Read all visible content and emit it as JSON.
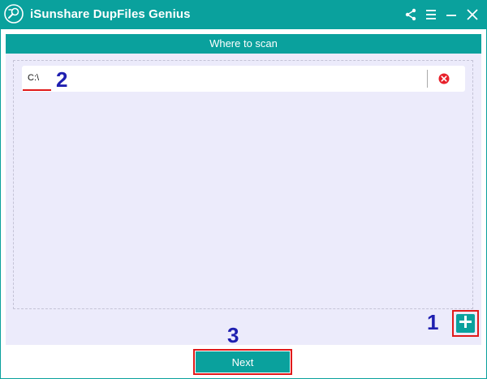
{
  "window": {
    "title": "iSunshare DupFiles Genius",
    "icons": [
      "app-logo-icon",
      "share-icon",
      "menu-icon",
      "minimize-icon",
      "close-icon"
    ]
  },
  "panel": {
    "header": "Where to scan",
    "paths": [
      {
        "path": "C:\\",
        "remove_icon": "remove-circle-icon"
      }
    ],
    "add_icon": "plus-icon"
  },
  "footer": {
    "next_label": "Next"
  },
  "annotations": {
    "step1": "1",
    "step2": "2",
    "step3": "3"
  },
  "colors": {
    "accent": "#0aa19d",
    "panel_bg": "#ecebfb",
    "highlight": "#e01a1a",
    "annotation": "#1f1fb0",
    "remove": "#e8202a"
  }
}
